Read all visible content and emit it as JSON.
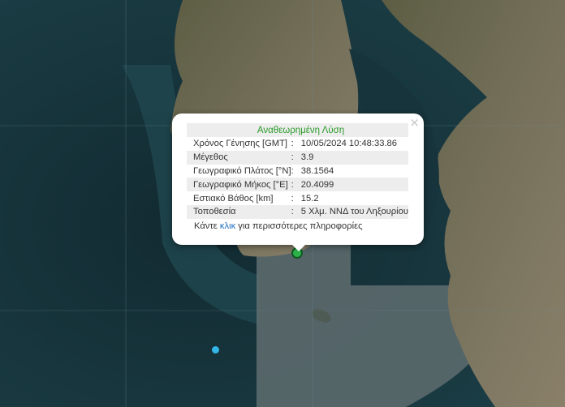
{
  "popup": {
    "title": "Αναθεωρημένη Λύση",
    "close": "×",
    "rows": [
      {
        "label": "Χρόνος Γένησης [GMT]",
        "value": "10/05/2024 10:48:33.86"
      },
      {
        "label": "Μέγεθος",
        "value": "3.9"
      },
      {
        "label": "Γεωγραφικό Πλάτος [°N]",
        "value": "38.1564"
      },
      {
        "label": "Γεωγραφικό Μήκος [°E]",
        "value": "20.4099"
      },
      {
        "label": "Εστιακό Βάθος [km]",
        "value": "15.2"
      },
      {
        "label": "Τοποθεσία",
        "value": "5 Χλμ. ΝΝΔ του Ληξουρίου"
      }
    ],
    "separator": ":",
    "more_prefix": "Κάντε",
    "more_link": "κλικ",
    "more_suffix": "για περισσότερες πληροφορίες"
  },
  "colors": {
    "sea": "#16323a",
    "land": "#6b6a4c",
    "title_green": "#2a9a2a",
    "link_blue": "#1f6fc0",
    "event_marker": "#2db34a",
    "secondary_marker": "#33b6e8"
  }
}
